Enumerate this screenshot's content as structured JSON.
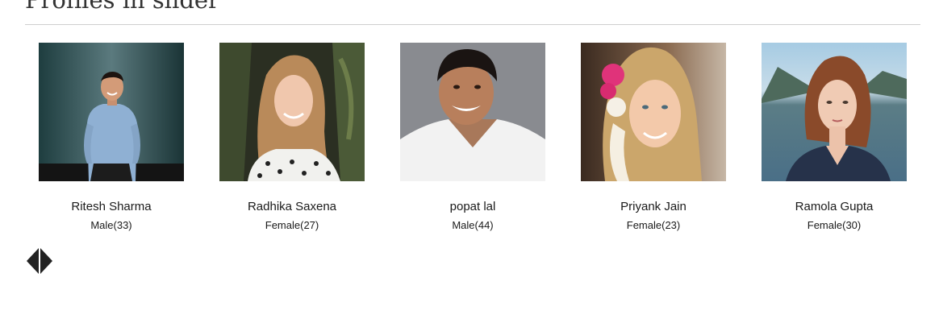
{
  "section": {
    "title": "Profiles in slider"
  },
  "profiles": [
    {
      "name": "Ritesh Sharma",
      "meta": "Male(33)"
    },
    {
      "name": "Radhika Saxena",
      "meta": "Female(27)"
    },
    {
      "name": "popat lal",
      "meta": "Male(44)"
    },
    {
      "name": "Priyank Jain",
      "meta": "Female(23)"
    },
    {
      "name": "Ramola Gupta",
      "meta": "Female(30)"
    }
  ],
  "navigation": {
    "prev_icon": "chevron-left-icon",
    "next_icon": "chevron-right-icon"
  },
  "colors": {
    "divider": "#cfcfcf",
    "nav": "#222222",
    "text": "#1a1a1a"
  }
}
